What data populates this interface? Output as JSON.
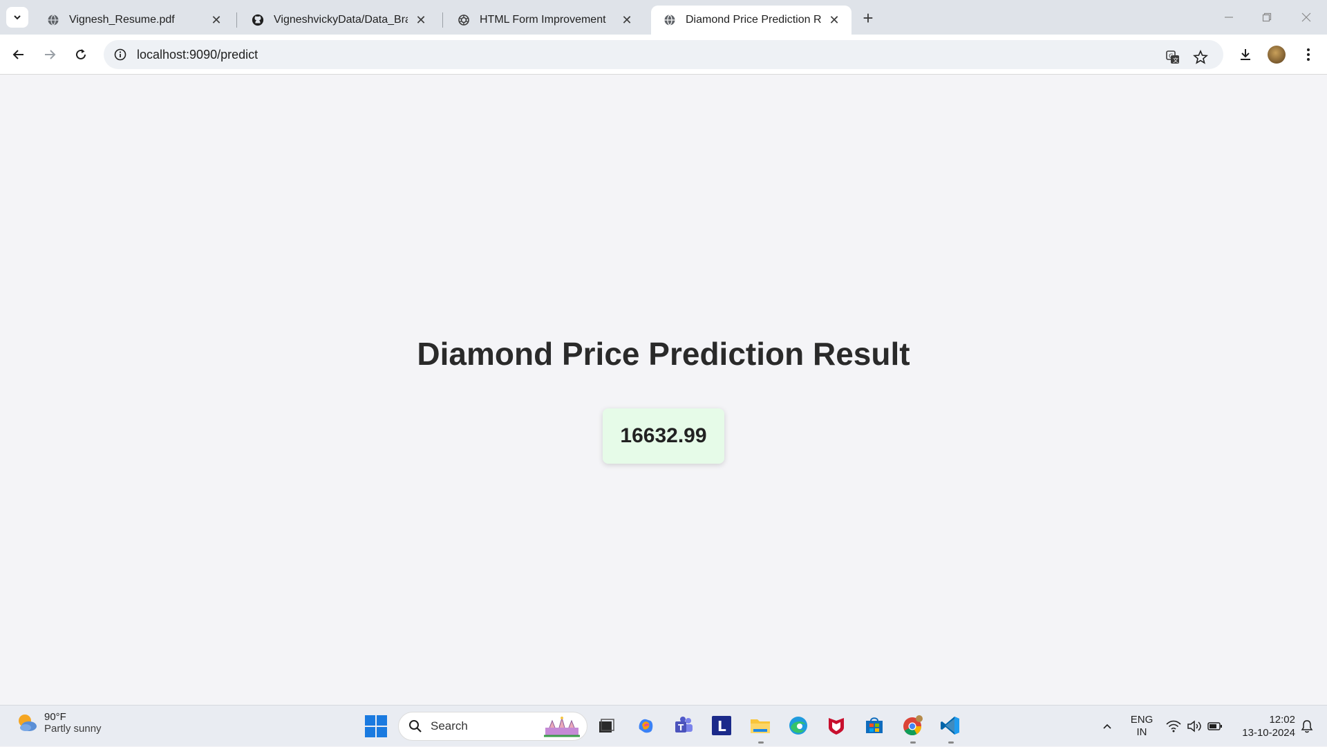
{
  "browser": {
    "tabs": [
      {
        "title": "Vignesh_Resume.pdf",
        "icon": "globe-icon",
        "active": false
      },
      {
        "title": "VigneshvickyData/Data_Branching",
        "icon": "github-icon",
        "active": false
      },
      {
        "title": "HTML Form Improvement",
        "icon": "openai-icon",
        "active": false
      },
      {
        "title": "Diamond Price Prediction Result",
        "icon": "globe-icon",
        "active": true
      }
    ],
    "url": "localhost:9090/predict"
  },
  "page": {
    "title": "Diamond Price Prediction Result",
    "prediction": "16632.99"
  },
  "taskbar": {
    "weather_temp": "90°F",
    "weather_condition": "Partly sunny",
    "search_label": "Search",
    "lang_top": "ENG",
    "lang_bottom": "IN",
    "time": "12:02",
    "date": "13-10-2024"
  },
  "colors": {
    "result_bg": "#e6fbe8",
    "page_bg": "#f4f4f7",
    "accent": "#1a7ae0"
  }
}
